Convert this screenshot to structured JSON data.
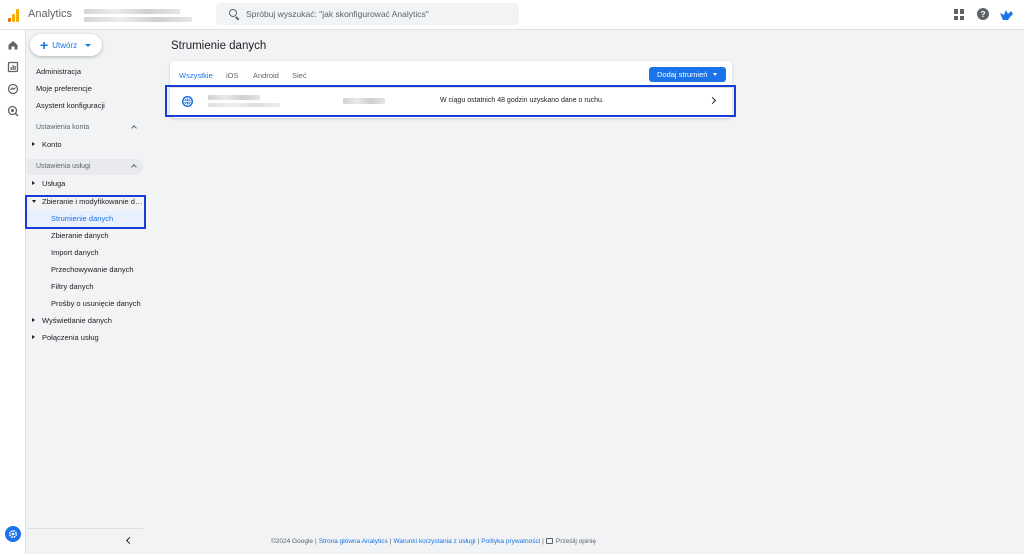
{
  "header": {
    "app_name": "Analytics",
    "search_placeholder": "Spróbuj wyszukać: \"jak skonfigurować Analytics\""
  },
  "colors": {
    "accent": "#1a73e8",
    "highlight": "#1a3cd6"
  },
  "nav": {
    "create_label": "Utwórz",
    "admin": "Administracja",
    "preferences": "Moje preferencje",
    "setup_assistant": "Asystent konfiguracji",
    "section_account": "Ustawienia konta",
    "account": "Konto",
    "section_property": "Ustawienia usługi",
    "property": "Usługa",
    "data_collection_group": "Zbieranie i modyfikowanie da...",
    "data_streams": "Strumienie danych",
    "data_collection": "Zbieranie danych",
    "data_import": "Import danych",
    "data_retention": "Przechowywanie danych",
    "data_filters": "Filtry danych",
    "data_deletion": "Prośby o usunięcie danych",
    "data_display": "Wyświetlanie danych",
    "product_links": "Połączenia usług"
  },
  "main": {
    "title": "Strumienie danych",
    "tabs": [
      "Wszystkie",
      "iOS",
      "Android",
      "Sieć"
    ],
    "add_stream": "Dodaj strumień",
    "stream_status": "W ciągu ostatnich 48 godzin uzyskano dane o ruchu."
  },
  "footer": {
    "copyright": "©2024 Google",
    "link_home": "Strona główna Analytics",
    "link_terms": "Warunki korzystania z usługi",
    "link_privacy": "Polityka prywatności",
    "feedback": "Prześlij opinię"
  }
}
